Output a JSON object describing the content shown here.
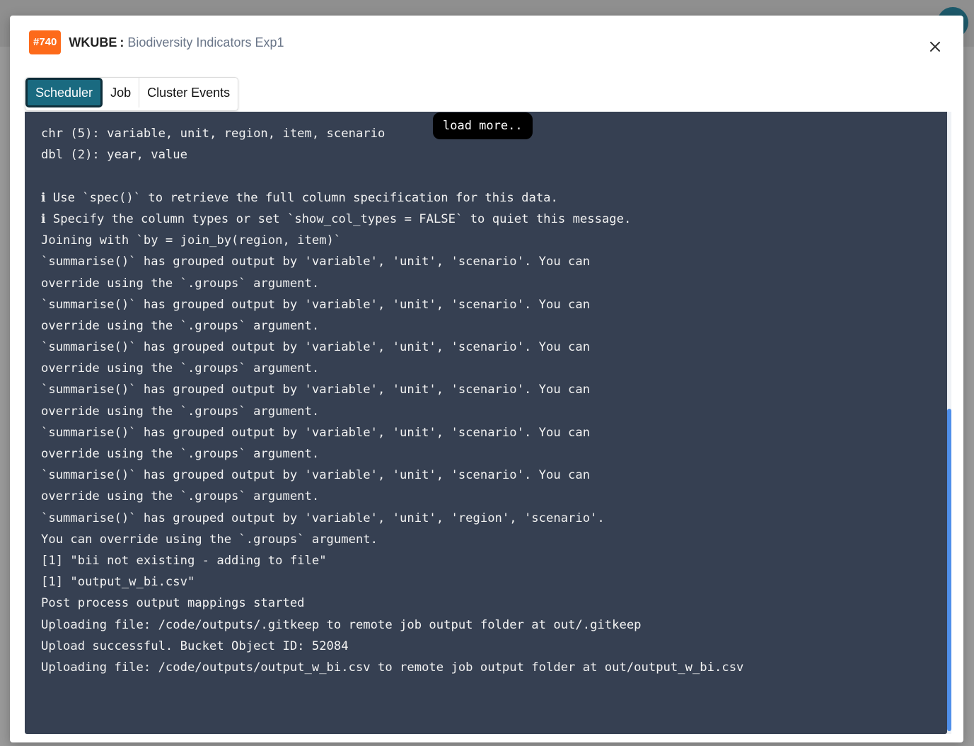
{
  "modal": {
    "job_id": "#740",
    "app_name": "WKUBE",
    "separator": ":",
    "job_name": "Biodiversity Indicators Exp1"
  },
  "tabs": [
    {
      "label": "Scheduler",
      "active": true
    },
    {
      "label": "Job",
      "active": false
    },
    {
      "label": "Cluster Events",
      "active": false
    }
  ],
  "console": {
    "load_more_label": "load more..",
    "lines": [
      "chr (5): variable, unit, region, item, scenario",
      "dbl (2): year, value",
      "",
      "ℹ Use `spec()` to retrieve the full column specification for this data.",
      "ℹ Specify the column types or set `show_col_types = FALSE` to quiet this message.",
      "Joining with `by = join_by(region, item)`",
      "`summarise()` has grouped output by 'variable', 'unit', 'scenario'. You can",
      "override using the `.groups` argument.",
      "`summarise()` has grouped output by 'variable', 'unit', 'scenario'. You can",
      "override using the `.groups` argument.",
      "`summarise()` has grouped output by 'variable', 'unit', 'scenario'. You can",
      "override using the `.groups` argument.",
      "`summarise()` has grouped output by 'variable', 'unit', 'scenario'. You can",
      "override using the `.groups` argument.",
      "`summarise()` has grouped output by 'variable', 'unit', 'scenario'. You can",
      "override using the `.groups` argument.",
      "`summarise()` has grouped output by 'variable', 'unit', 'scenario'. You can",
      "override using the `.groups` argument.",
      "`summarise()` has grouped output by 'variable', 'unit', 'region', 'scenario'.",
      "You can override using the `.groups` argument.",
      "[1] \"bii not existing - adding to file\"",
      "[1] \"output_w_bi.csv\"",
      "Post process output mappings started",
      "Uploading file: /code/outputs/.gitkeep to remote job output folder at out/.gitkeep",
      "Upload successful. Bucket Object ID: 52084",
      "Uploading file: /code/outputs/output_w_bi.csv to remote job output folder at out/output_w_bi.csv"
    ]
  },
  "icons": {
    "close": "close-icon"
  },
  "colors": {
    "badge": "#fd6a1a",
    "active_tab": "#1a6a80",
    "console_bg": "#364052",
    "scrollbar_thumb": "#4f8fea"
  }
}
